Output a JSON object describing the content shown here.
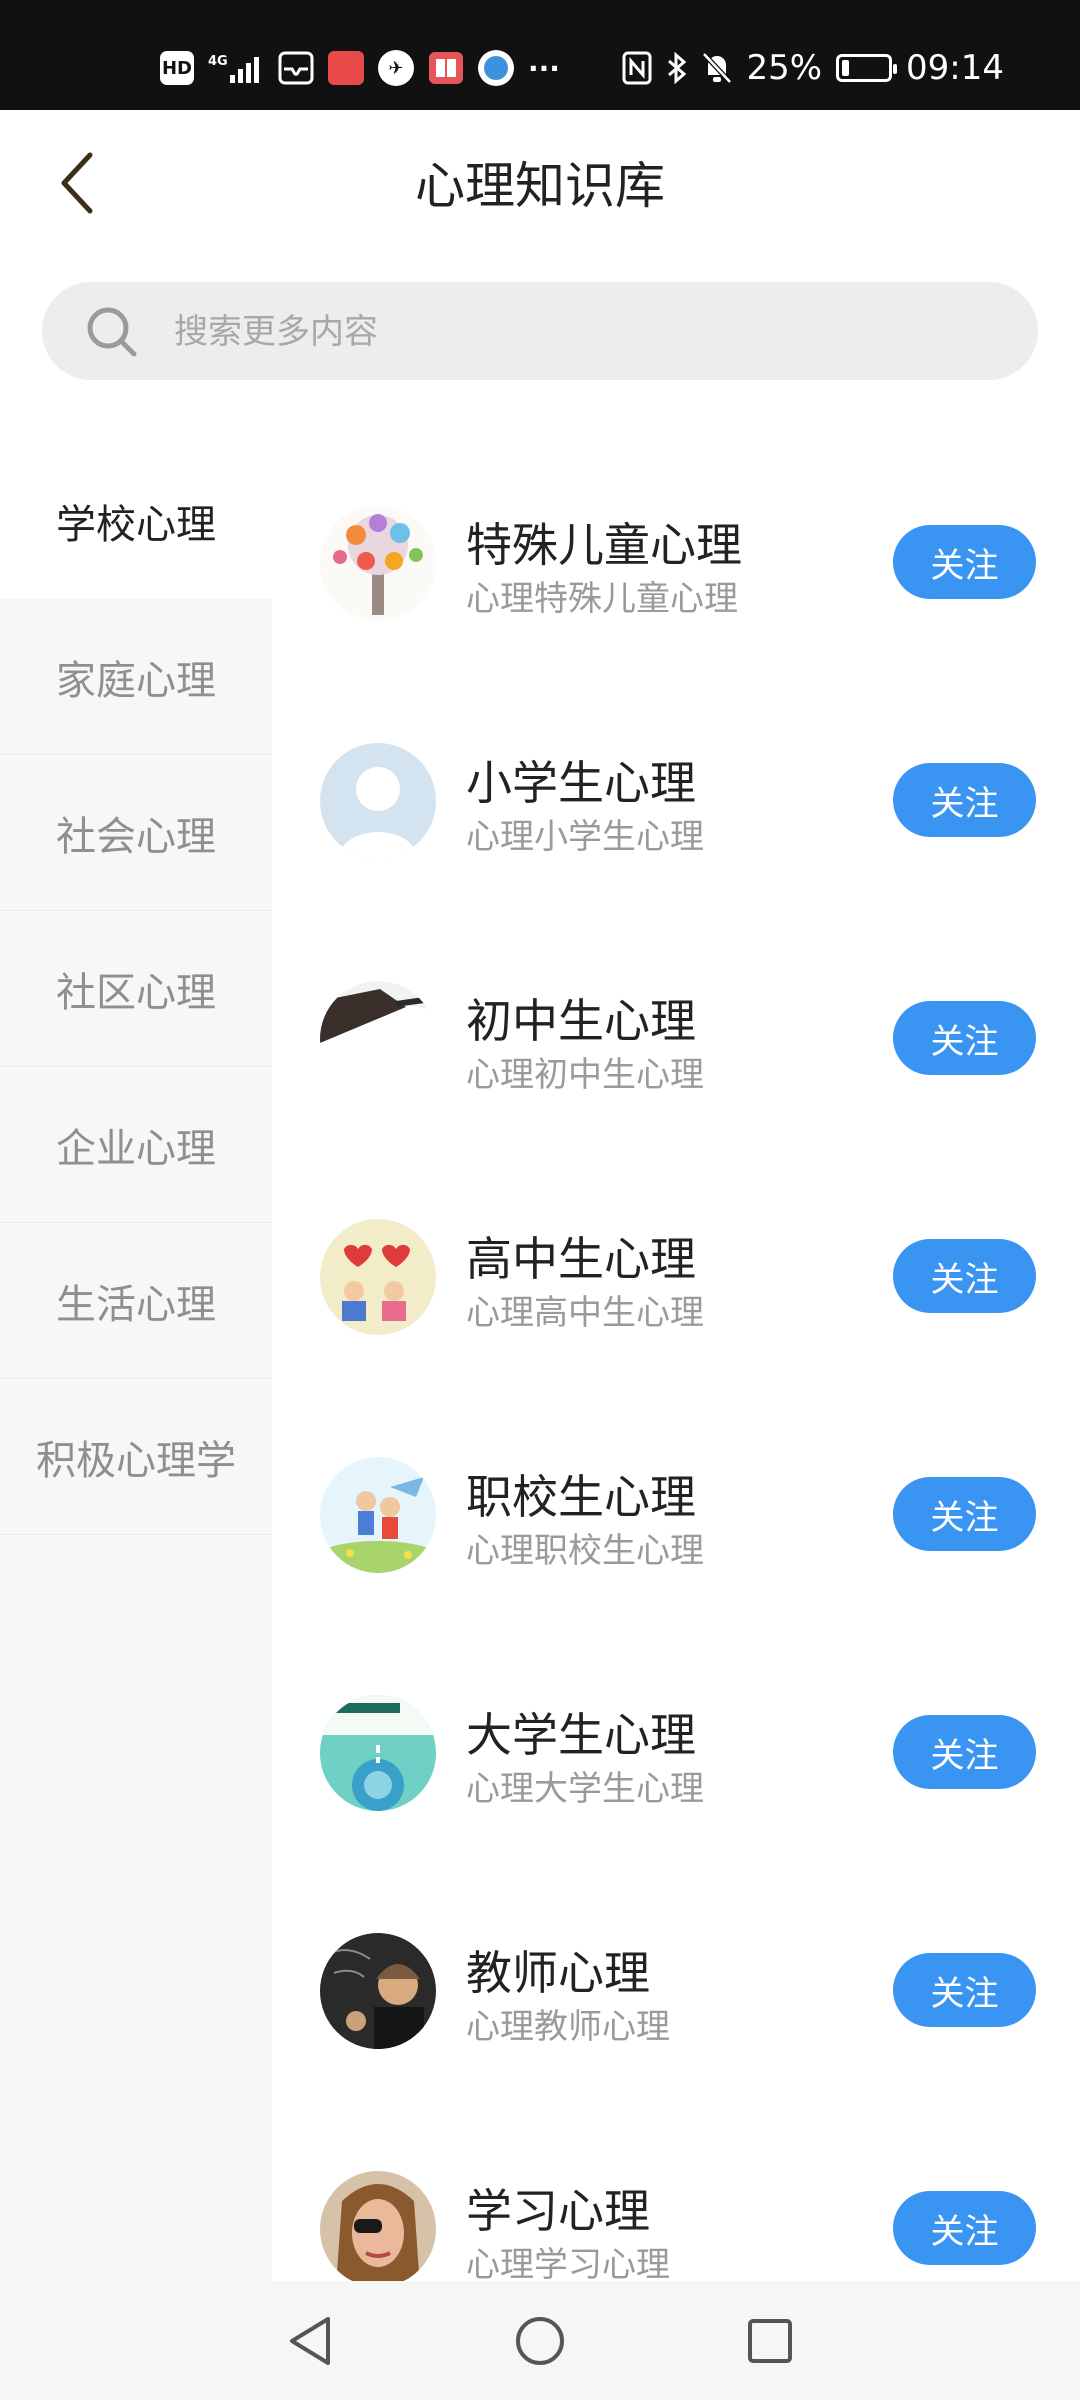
{
  "status_bar": {
    "network": "4G",
    "hd": "HD",
    "battery": "25%",
    "battery_level": 0.25,
    "time": "09:14",
    "more": "···"
  },
  "header": {
    "title": "心理知识库",
    "back_icon": "chevron-left-icon"
  },
  "search": {
    "placeholder": "搜索更多内容",
    "value": ""
  },
  "sidebar": {
    "categories": [
      {
        "label": "学校心理",
        "active": true
      },
      {
        "label": "家庭心理",
        "active": false
      },
      {
        "label": "社会心理",
        "active": false
      },
      {
        "label": "社区心理",
        "active": false
      },
      {
        "label": "企业心理",
        "active": false
      },
      {
        "label": "生活心理",
        "active": false
      },
      {
        "label": "积极心理学",
        "active": false
      }
    ]
  },
  "list": {
    "items": [
      {
        "title": "特殊儿童心理",
        "subtitle": "心理特殊儿童心理",
        "button": "关注"
      },
      {
        "title": "小学生心理",
        "subtitle": "心理小学生心理",
        "button": "关注"
      },
      {
        "title": "初中生心理",
        "subtitle": "心理初中生心理",
        "button": "关注"
      },
      {
        "title": "高中生心理",
        "subtitle": "心理高中生心理",
        "button": "关注"
      },
      {
        "title": "职校生心理",
        "subtitle": "心理职校生心理",
        "button": "关注"
      },
      {
        "title": "大学生心理",
        "subtitle": "心理大学生心理",
        "button": "关注"
      },
      {
        "title": "教师心理",
        "subtitle": "心理教师心理",
        "button": "关注"
      },
      {
        "title": "学习心理",
        "subtitle": "心理学习心理",
        "button": "关注"
      }
    ]
  },
  "colors": {
    "accent": "#3a95f2",
    "sidebar_bg": "#f7f7f7",
    "search_bg": "#ededed",
    "status_bar_bg": "#111111"
  }
}
